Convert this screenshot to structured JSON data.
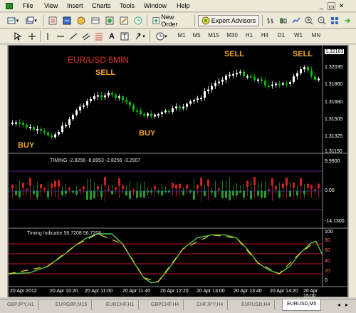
{
  "menu": {
    "items": [
      "File",
      "View",
      "Insert",
      "Charts",
      "Tools",
      "Window",
      "Help"
    ]
  },
  "toolbar1": {
    "new_order": "New Order",
    "expert_advisors": "Expert Advisors"
  },
  "toolbar2": {
    "text_tool": "A",
    "timeframes": [
      "M1",
      "M5",
      "M15",
      "M30",
      "H1",
      "H4",
      "D1",
      "W1",
      "MN"
    ]
  },
  "chart": {
    "symbol_label": "EUR/USD 5MIN",
    "annotations": {
      "sell_1": "SELL",
      "sell_2": "SELL",
      "sell_3": "SELL",
      "buy_1": "BUY",
      "buy_2": "BUY"
    },
    "price_labels": [
      "1.32183",
      "1.32035",
      "1.31860",
      "1.31680",
      "1.31505",
      "1.31325",
      "1.31150"
    ],
    "timing_title": "TIMING  -2.8256 -6.8953 -2.8256 -3.2907",
    "timing_labels": [
      "9.9900",
      "0.00",
      "-14.1300"
    ],
    "indicator_title": "Timing Indicator 56.7208 56.7208",
    "indicator_labels": [
      "100",
      "80",
      "60",
      "40",
      "20",
      "0"
    ],
    "time_labels": [
      "20 Apr 2012",
      "20 Apr 10:20",
      "20 Apr 11:00",
      "20 Apr 11:40",
      "20 Apr 12:20",
      "20 Apr 13:00",
      "20 Apr 13:40",
      "20 Apr 14:20",
      "20 Apr 15:00"
    ],
    "colors": {
      "background": "#000000",
      "bull_candle": "#ffffff",
      "bear_candle": "#00c000",
      "sell_text": "#f5a623",
      "buy_text": "#f5a623",
      "symbol_text": "#e03020",
      "histogram_up": "#2a9a2a",
      "histogram_down": "#d02020",
      "level_purple": "#7030a0",
      "level_red": "#c01030",
      "osc_green": "#4ec84e",
      "osc_yellow": "#f0d020"
    }
  },
  "tabs": [
    "GBPJPY,H1",
    "EURGBP,M15",
    "EURCHF,H1",
    "GBPCHF,H4",
    "CHFJPY,H4",
    "EURUSD,H4",
    "EURUSD,M5"
  ],
  "active_tab": "EURUSD,M5"
}
